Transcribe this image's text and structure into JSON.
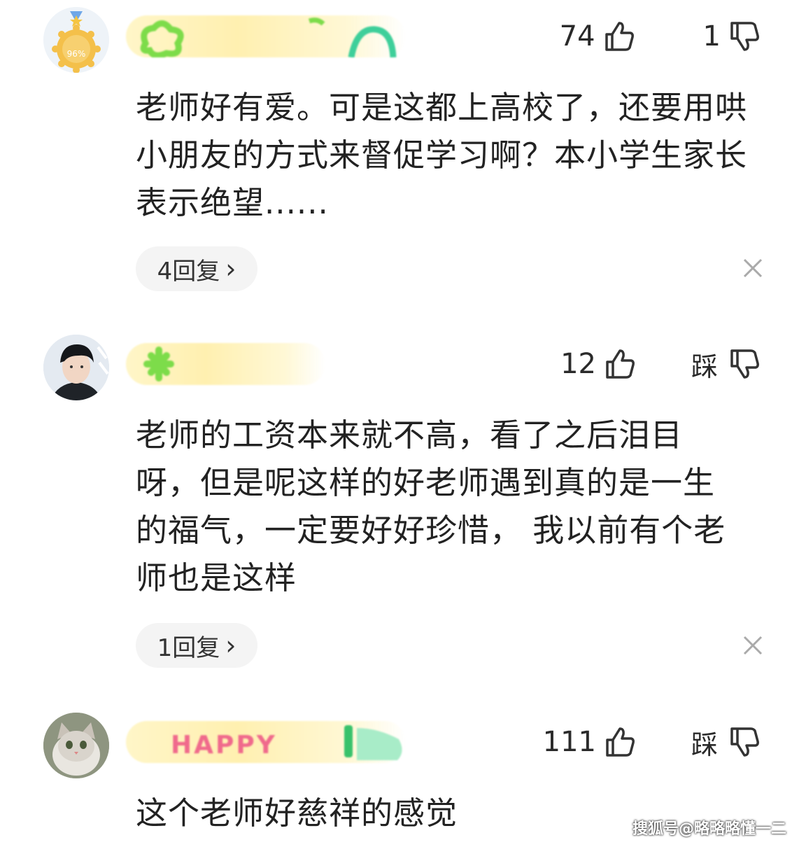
{
  "comments": [
    {
      "avatar": "badge-avatar",
      "badge_text": "96%",
      "likes": "74",
      "dislike": "1",
      "text": "老师好有爱。可是这都上高校了，还要用哄小朋友的方式来督促学习啊？本小学生家长表示绝望......",
      "replies": "4回复",
      "reply_chevron": "›"
    },
    {
      "avatar": "person-avatar",
      "likes": "12",
      "dislike": "踩",
      "text": "老师的工资本来就不高，看了之后泪目呀，但是呢这样的好老师遇到真的是一生的福气，一定要好好珍惜， 我以前有个老师也是这样",
      "replies": "1回复",
      "reply_chevron": "›"
    },
    {
      "avatar": "cat-avatar",
      "name_sticker": "HAPPY",
      "likes": "111",
      "dislike": "踩",
      "text": "这个老师好慈祥的感觉"
    }
  ],
  "watermark": "搜狐号@略略略懂一二",
  "colors": {
    "sticker_green": "#7ddc4a",
    "sticker_pink": "#f06a8c",
    "name_blur": "#fff2b8",
    "badge_gold": "#f2b53a"
  }
}
